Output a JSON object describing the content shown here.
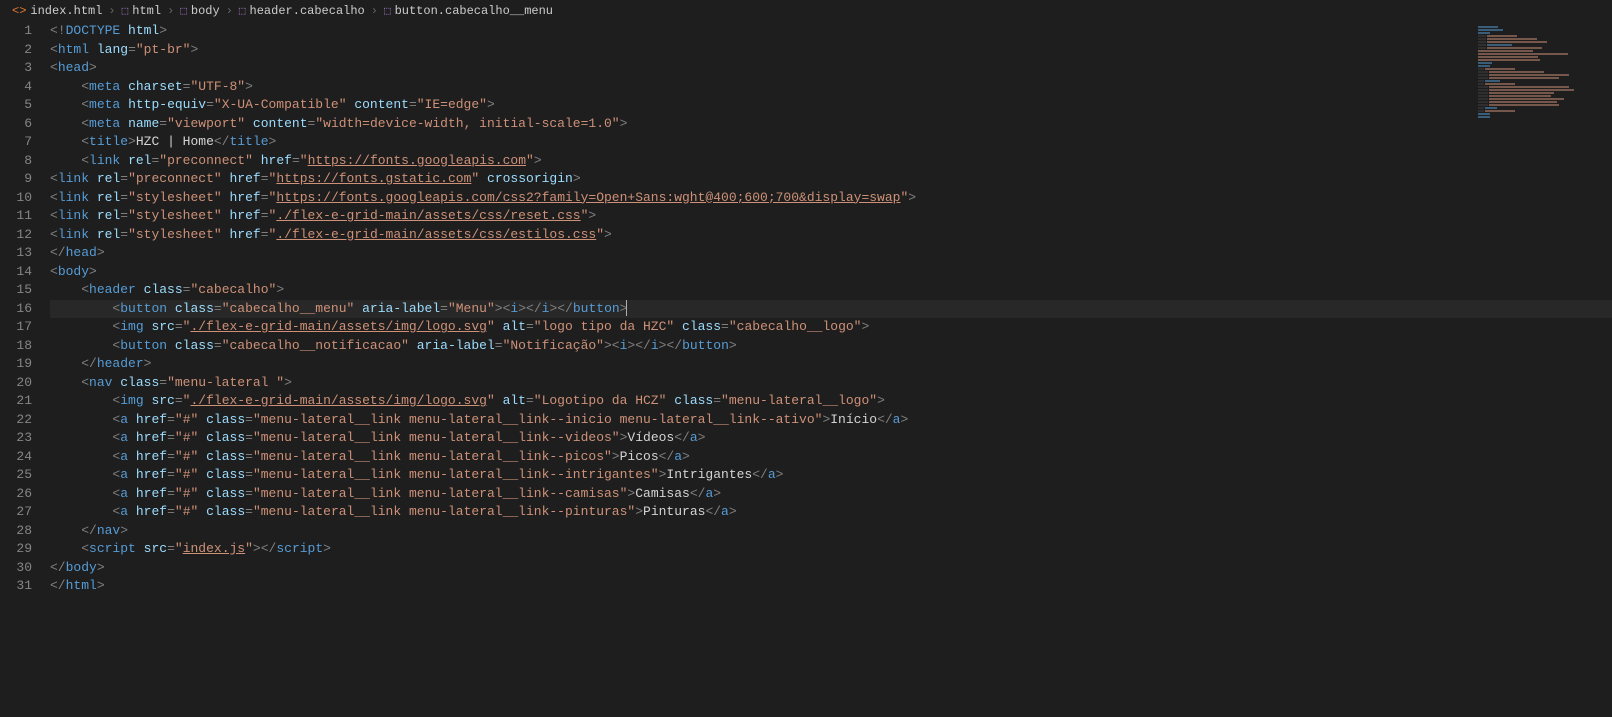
{
  "breadcrumb": {
    "items": [
      {
        "icon": "file",
        "label": "index.html"
      },
      {
        "icon": "cube",
        "label": "html"
      },
      {
        "icon": "cube",
        "label": "body"
      },
      {
        "icon": "cube",
        "label": "header.cabecalho"
      },
      {
        "icon": "cube",
        "label": "button.cabecalho__menu"
      }
    ]
  },
  "gutter": [
    "1",
    "2",
    "3",
    "4",
    "5",
    "6",
    "7",
    "8",
    "9",
    "10",
    "11",
    "12",
    "13",
    "14",
    "15",
    "16",
    "17",
    "18",
    "19",
    "20",
    "21",
    "22",
    "23",
    "24",
    "25",
    "26",
    "27",
    "28",
    "29",
    "30",
    "31"
  ],
  "code": {
    "l1": {
      "open": "<!",
      "doctype": "DOCTYPE",
      "sp": " ",
      "html": "html",
      "close": ">"
    },
    "l2": {
      "open": "<",
      "tag": "html",
      "sp": " ",
      "a1": "lang",
      "eq": "=",
      "v1": "\"pt-br\"",
      "close": ">"
    },
    "l3": {
      "open": "<",
      "tag": "head",
      "close": ">"
    },
    "l4": {
      "open": "<",
      "tag": "meta",
      "sp": " ",
      "a1": "charset",
      "eq": "=",
      "v1": "\"UTF-8\"",
      "close": ">"
    },
    "l5": {
      "open": "<",
      "tag": "meta",
      "sp": " ",
      "a1": "http-equiv",
      "eq": "=",
      "v1": "\"X-UA-Compatible\"",
      "sp2": " ",
      "a2": "content",
      "v2": "\"IE=edge\"",
      "close": ">"
    },
    "l6": {
      "open": "<",
      "tag": "meta",
      "sp": " ",
      "a1": "name",
      "eq": "=",
      "v1": "\"viewport\"",
      "sp2": " ",
      "a2": "content",
      "v2": "\"width=device-width, initial-scale=1.0\"",
      "close": ">"
    },
    "l7": {
      "open": "<",
      "tag": "title",
      "close": ">",
      "text": "HZC | Home",
      "open2": "</",
      "tag2": "title",
      "close2": ">"
    },
    "l8": {
      "open": "<",
      "tag": "link",
      "sp": " ",
      "a1": "rel",
      "eq": "=",
      "v1": "\"preconnect\"",
      "sp2": " ",
      "a2": "href",
      "v2q": "\"",
      "v2": "https://fonts.googleapis.com",
      "v2q2": "\"",
      "close": ">"
    },
    "l9": {
      "open": "<",
      "tag": "link",
      "sp": " ",
      "a1": "rel",
      "eq": "=",
      "v1": "\"preconnect\"",
      "sp2": " ",
      "a2": "href",
      "v2q": "\"",
      "v2": "https://fonts.gstatic.com",
      "v2q2": "\"",
      "sp3": " ",
      "a3": "crossorigin",
      "close": ">"
    },
    "l10": {
      "open": "<",
      "tag": "link",
      "sp": " ",
      "a1": "rel",
      "eq": "=",
      "v1": "\"stylesheet\"",
      "sp2": " ",
      "a2": "href",
      "v2q": "\"",
      "v2": "https://fonts.googleapis.com/css2?family=Open+Sans:wght@400;600;700&display=swap",
      "v2q2": "\"",
      "close": ">"
    },
    "l11": {
      "open": "<",
      "tag": "link",
      "sp": " ",
      "a1": "rel",
      "eq": "=",
      "v1": "\"stylesheet\"",
      "sp2": " ",
      "a2": "href",
      "v2q": "\"",
      "v2": "./flex-e-grid-main/assets/css/reset.css",
      "v2q2": "\"",
      "close": ">"
    },
    "l12": {
      "open": "<",
      "tag": "link",
      "sp": " ",
      "a1": "rel",
      "eq": "=",
      "v1": "\"stylesheet\"",
      "sp2": " ",
      "a2": "href",
      "v2q": "\"",
      "v2": "./flex-e-grid-main/assets/css/estilos.css",
      "v2q2": "\"",
      "close": ">"
    },
    "l13": {
      "open": "</",
      "tag": "head",
      "close": ">"
    },
    "l14": {
      "open": "<",
      "tag": "body",
      "close": ">"
    },
    "l15": {
      "open": "<",
      "tag": "header",
      "sp": " ",
      "a1": "class",
      "eq": "=",
      "v1": "\"cabecalho\"",
      "close": ">"
    },
    "l16": {
      "open": "<",
      "tag": "button",
      "sp": " ",
      "a1": "class",
      "eq": "=",
      "v1": "\"cabecalho__menu\"",
      "sp2": " ",
      "a2": "aria-label",
      "v2": "\"Menu\"",
      "close": ">",
      "open2": "<",
      "tag2": "i",
      "close2": ">",
      "open3": "</",
      "tag3": "i",
      "close3": ">",
      "open4": "</",
      "tag4": "button",
      "close4": ">"
    },
    "l17": {
      "open": "<",
      "tag": "img",
      "sp": " ",
      "a1": "src",
      "eq": "=",
      "v1q": "\"",
      "v1": "./flex-e-grid-main/assets/img/logo.svg",
      "v1q2": "\"",
      "sp2": " ",
      "a2": "alt",
      "v2": "\"logo tipo da HZC\"",
      "sp3": " ",
      "a3": "class",
      "v3": "\"cabecalho__logo\"",
      "close": ">"
    },
    "l18": {
      "open": "<",
      "tag": "button",
      "sp": " ",
      "a1": "class",
      "eq": "=",
      "v1": "\"cabecalho__notificacao\"",
      "sp2": " ",
      "a2": "aria-label",
      "v2": "\"Notificação\"",
      "close": ">",
      "open2": "<",
      "tag2": "i",
      "close2": ">",
      "open3": "</",
      "tag3": "i",
      "close3": ">",
      "open4": "</",
      "tag4": "button",
      "close4": ">"
    },
    "l19": {
      "open": "</",
      "tag": "header",
      "close": ">"
    },
    "l20": {
      "open": "<",
      "tag": "nav",
      "sp": " ",
      "a1": "class",
      "eq": "=",
      "v1": "\"menu-lateral \"",
      "close": ">"
    },
    "l21": {
      "open": "<",
      "tag": "img",
      "sp": " ",
      "a1": "src",
      "eq": "=",
      "v1q": "\"",
      "v1": "./flex-e-grid-main/assets/img/logo.svg",
      "v1q2": "\"",
      "sp2": " ",
      "a2": "alt",
      "v2": "\"Logotipo da HCZ\"",
      "sp3": " ",
      "a3": "class",
      "v3": "\"menu-lateral__logo\"",
      "close": ">"
    },
    "l22": {
      "open": "<",
      "tag": "a",
      "sp": " ",
      "a1": "href",
      "eq": "=",
      "v1": "\"#\"",
      "sp2": " ",
      "a2": "class",
      "v2": "\"menu-lateral__link menu-lateral__link--inicio menu-lateral__link--ativo\"",
      "close": ">",
      "text": "Início",
      "open2": "</",
      "tag2": "a",
      "close2": ">"
    },
    "l23": {
      "open": "<",
      "tag": "a",
      "sp": " ",
      "a1": "href",
      "eq": "=",
      "v1": "\"#\"",
      "sp2": " ",
      "a2": "class",
      "v2": "\"menu-lateral__link menu-lateral__link--videos\"",
      "close": ">",
      "text": "Vídeos",
      "open2": "</",
      "tag2": "a",
      "close2": ">"
    },
    "l24": {
      "open": "<",
      "tag": "a",
      "sp": " ",
      "a1": "href",
      "eq": "=",
      "v1": "\"#\"",
      "sp2": " ",
      "a2": "class",
      "v2": "\"menu-lateral__link menu-lateral__link--picos\"",
      "close": ">",
      "text": "Picos",
      "open2": "</",
      "tag2": "a",
      "close2": ">"
    },
    "l25": {
      "open": "<",
      "tag": "a",
      "sp": " ",
      "a1": "href",
      "eq": "=",
      "v1": "\"#\"",
      "sp2": " ",
      "a2": "class",
      "v2": "\"menu-lateral__link menu-lateral__link--intrigantes\"",
      "close": ">",
      "text": "Intrigantes",
      "open2": "</",
      "tag2": "a",
      "close2": ">"
    },
    "l26": {
      "open": "<",
      "tag": "a",
      "sp": " ",
      "a1": "href",
      "eq": "=",
      "v1": "\"#\"",
      "sp2": " ",
      "a2": "class",
      "v2": "\"menu-lateral__link menu-lateral__link--camisas\"",
      "close": ">",
      "text": "Camisas",
      "open2": "</",
      "tag2": "a",
      "close2": ">"
    },
    "l27": {
      "open": "<",
      "tag": "a",
      "sp": " ",
      "a1": "href",
      "eq": "=",
      "v1": "\"#\"",
      "sp2": " ",
      "a2": "class",
      "v2": "\"menu-lateral__link menu-lateral__link--pinturas\"",
      "close": ">",
      "text": "Pinturas",
      "open2": "</",
      "tag2": "a",
      "close2": ">"
    },
    "l28": {
      "open": "</",
      "tag": "nav",
      "close": ">"
    },
    "l29": {
      "open": "<",
      "tag": "script",
      "sp": " ",
      "a1": "src",
      "eq": "=",
      "v1q": "\"",
      "v1": "index.js",
      "v1q2": "\"",
      "close": ">",
      "open2": "</",
      "tag2": "script",
      "close2": ">"
    },
    "l30": {
      "open": "</",
      "tag": "body",
      "close": ">"
    },
    "l31": {
      "open": "</",
      "tag": "html",
      "close": ">"
    }
  }
}
